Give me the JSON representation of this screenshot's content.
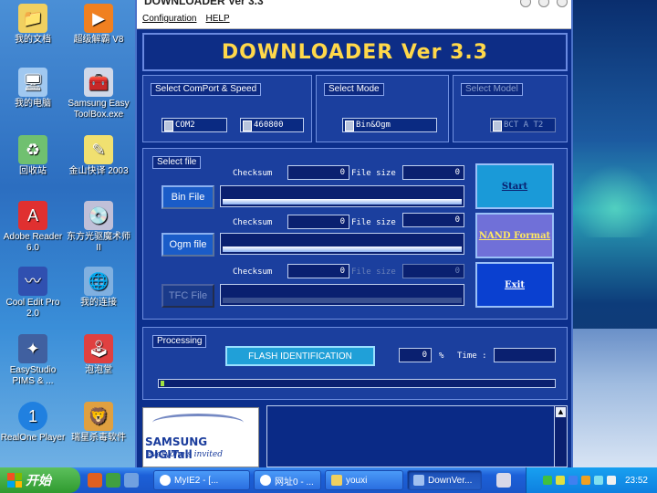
{
  "window": {
    "title": "DOWNLOADER Ver 3.3"
  },
  "menu": {
    "items": [
      "Configuration",
      "HELP"
    ]
  },
  "header": {
    "title": "DOWNLOADER Ver 3.3"
  },
  "comport": {
    "legend": "Select ComPort & Speed",
    "port": "COM2",
    "speed": "460800"
  },
  "mode": {
    "legend": "Select Mode",
    "value": "Bin&Ogm"
  },
  "model": {
    "legend": "Select Model",
    "value": "BCT A T2"
  },
  "files": {
    "legend": "Select file",
    "checksum_label": "Checksum",
    "filesize_label": "File size",
    "rows": [
      {
        "button": "Bin File",
        "checksum": "0",
        "filesize": "0"
      },
      {
        "button": "Ogm file",
        "checksum": "0",
        "filesize": "0"
      },
      {
        "button": "TFC File",
        "checksum": "0",
        "filesize": "0"
      }
    ]
  },
  "actions": {
    "start": "Start",
    "nand": "NAND Format",
    "exit": "Exit"
  },
  "processing": {
    "legend": "Processing",
    "flash_button": "FLASH IDENTIFICATION",
    "percent": "0",
    "percent_unit": "%",
    "time_label": "Time :"
  },
  "logo": {
    "brand": "SAMSUNG DIGITall",
    "tagline": "everyone's invited"
  },
  "desktop_icons": [
    {
      "label": "我的文档"
    },
    {
      "label": "超级解霸 V8"
    },
    {
      "label": "我的电脑"
    },
    {
      "label": "Samsung Easy ToolBox.exe"
    },
    {
      "label": "回收站"
    },
    {
      "label": "金山快译 2003"
    },
    {
      "label": "Adobe Reader 6.0"
    },
    {
      "label": "东方光驱魔术师II"
    },
    {
      "label": "Cool Edit Pro 2.0"
    },
    {
      "label": "我的连接"
    },
    {
      "label": "EasyStudio PIMS & ..."
    },
    {
      "label": "泡泡堂"
    },
    {
      "label": "RealOne Player"
    },
    {
      "label": "瑞星杀毒软件"
    }
  ],
  "taskbar": {
    "start": "开始",
    "tasks": [
      "MyIE2 - [...",
      "网址0 - ...",
      "youxi",
      "DownVer..."
    ],
    "clock": "23:52"
  }
}
